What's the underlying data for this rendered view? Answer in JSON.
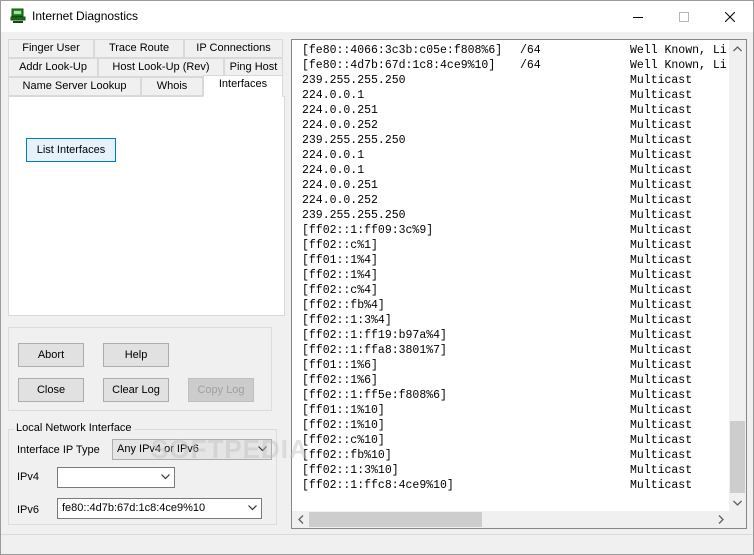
{
  "window": {
    "title": "Internet Diagnostics"
  },
  "tabs": [
    {
      "label": "Finger User"
    },
    {
      "label": "Trace Route"
    },
    {
      "label": "IP Connections"
    },
    {
      "label": "Addr Look-Up"
    },
    {
      "label": "Host Look-Up (Rev)"
    },
    {
      "label": "Ping Host"
    },
    {
      "label": "Name Server Lookup"
    },
    {
      "label": "Whois"
    },
    {
      "label": "Interfaces"
    }
  ],
  "active_tab": "Interfaces",
  "interfaces_panel": {
    "list_button": "List Interfaces"
  },
  "actions": {
    "abort": "Abort",
    "help": "Help",
    "close": "Close",
    "clear_log": "Clear Log",
    "copy_log": "Copy Log"
  },
  "network": {
    "group_label": "Local Network Interface",
    "type_label": "Interface IP Type",
    "type_value": "Any IPv4 or IPv6",
    "ipv4_label": "IPv4",
    "ipv4_value": "",
    "ipv6_label": "IPv6",
    "ipv6_value": "fe80::4d7b:67d:1c8:4ce9%10"
  },
  "log": [
    {
      "addr": "[fe80::4066:3c3b:c05e:f808%6]",
      "prefix": "/64",
      "type": "Well Known, Li"
    },
    {
      "addr": "[fe80::4d7b:67d:1c8:4ce9%10]",
      "prefix": "/64",
      "type": "Well Known, Li"
    },
    {
      "addr": "239.255.255.250",
      "prefix": "",
      "type": "Multicast"
    },
    {
      "addr": "224.0.0.1",
      "prefix": "",
      "type": "Multicast"
    },
    {
      "addr": "224.0.0.251",
      "prefix": "",
      "type": "Multicast"
    },
    {
      "addr": "224.0.0.252",
      "prefix": "",
      "type": "Multicast"
    },
    {
      "addr": "239.255.255.250",
      "prefix": "",
      "type": "Multicast"
    },
    {
      "addr": "224.0.0.1",
      "prefix": "",
      "type": "Multicast"
    },
    {
      "addr": "224.0.0.1",
      "prefix": "",
      "type": "Multicast"
    },
    {
      "addr": "224.0.0.251",
      "prefix": "",
      "type": "Multicast"
    },
    {
      "addr": "224.0.0.252",
      "prefix": "",
      "type": "Multicast"
    },
    {
      "addr": "239.255.255.250",
      "prefix": "",
      "type": "Multicast"
    },
    {
      "addr": "[ff02::1:ff09:3c%9]",
      "prefix": "",
      "type": "Multicast"
    },
    {
      "addr": "[ff02::c%1]",
      "prefix": "",
      "type": "Multicast"
    },
    {
      "addr": "[ff01::1%4]",
      "prefix": "",
      "type": "Multicast"
    },
    {
      "addr": "[ff02::1%4]",
      "prefix": "",
      "type": "Multicast"
    },
    {
      "addr": "[ff02::c%4]",
      "prefix": "",
      "type": "Multicast"
    },
    {
      "addr": "[ff02::fb%4]",
      "prefix": "",
      "type": "Multicast"
    },
    {
      "addr": "[ff02::1:3%4]",
      "prefix": "",
      "type": "Multicast"
    },
    {
      "addr": "[ff02::1:ff19:b97a%4]",
      "prefix": "",
      "type": "Multicast"
    },
    {
      "addr": "[ff02::1:ffa8:3801%7]",
      "prefix": "",
      "type": "Multicast"
    },
    {
      "addr": "[ff01::1%6]",
      "prefix": "",
      "type": "Multicast"
    },
    {
      "addr": "[ff02::1%6]",
      "prefix": "",
      "type": "Multicast"
    },
    {
      "addr": "[ff02::1:ff5e:f808%6]",
      "prefix": "",
      "type": "Multicast"
    },
    {
      "addr": "[ff01::1%10]",
      "prefix": "",
      "type": "Multicast"
    },
    {
      "addr": "[ff02::1%10]",
      "prefix": "",
      "type": "Multicast"
    },
    {
      "addr": "[ff02::c%10]",
      "prefix": "",
      "type": "Multicast"
    },
    {
      "addr": "[ff02::fb%10]",
      "prefix": "",
      "type": "Multicast"
    },
    {
      "addr": "[ff02::1:3%10]",
      "prefix": "",
      "type": "Multicast"
    },
    {
      "addr": "[ff02::1:ffc8:4ce9%10]",
      "prefix": "",
      "type": "Multicast"
    }
  ],
  "watermark": "SOFTPEDIA",
  "colors": {
    "focus_border": "#0078d7",
    "focus_fill": "#e5f1fb",
    "window_bg": "#f0f0f0"
  }
}
